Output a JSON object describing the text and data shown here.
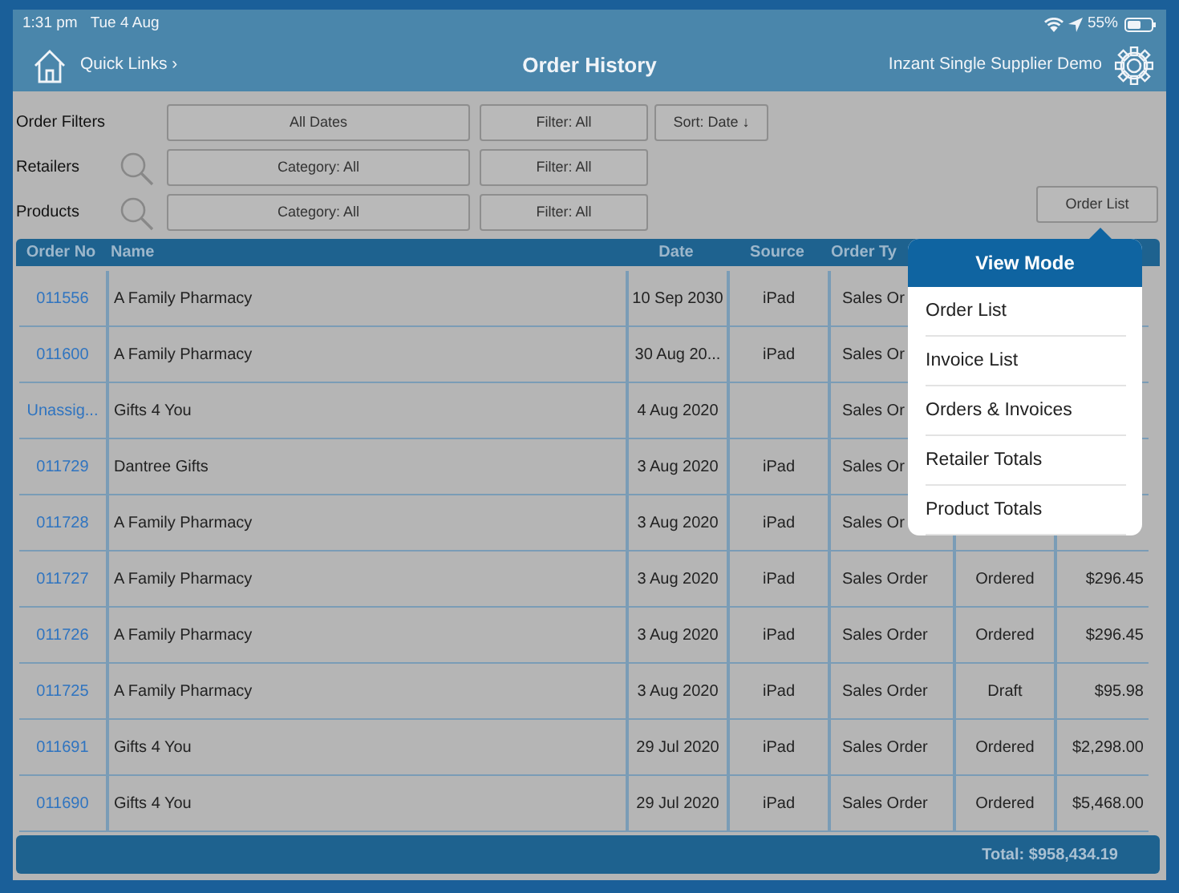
{
  "status_bar": {
    "time": "1:31 pm",
    "date": "Tue 4 Aug",
    "battery": "55%"
  },
  "nav": {
    "quick_links": "Quick Links ›",
    "title": "Order History",
    "account": "Inzant Single Supplier Demo"
  },
  "filters": [
    {
      "label": "Order Filters",
      "search": false,
      "buttons": [
        "All Dates",
        "Filter: All",
        "Sort: Date ↓"
      ]
    },
    {
      "label": "Retailers",
      "search": true,
      "buttons": [
        "Category: All",
        "Filter: All"
      ]
    },
    {
      "label": "Products",
      "search": true,
      "buttons": [
        "Category: All",
        "Filter: All"
      ]
    }
  ],
  "view_button": "Order List",
  "table": {
    "columns": [
      "Order No",
      "Name",
      "Date",
      "Source",
      "Order Ty"
    ],
    "rows": [
      {
        "order_no": "011556",
        "name": "A Family Pharmacy",
        "date": "10 Sep 2030",
        "source": "iPad",
        "order_type": "Sales Or"
      },
      {
        "order_no": "011600",
        "name": "A Family Pharmacy",
        "date": "30 Aug 20...",
        "source": "iPad",
        "order_type": "Sales Or"
      },
      {
        "order_no": "Unassig...",
        "name": "Gifts 4 You",
        "date": "4 Aug 2020",
        "order_type": "Sales Or"
      },
      {
        "order_no": "011729",
        "name": "Dantree Gifts",
        "date": "3 Aug 2020",
        "source": "iPad",
        "order_type": "Sales Or"
      },
      {
        "order_no": "011728",
        "name": "A Family Pharmacy",
        "date": "3 Aug 2020",
        "source": "iPad",
        "order_type": "Sales Or"
      },
      {
        "order_no": "011727",
        "name": "A Family Pharmacy",
        "date": "3 Aug 2020",
        "source": "iPad",
        "order_type": "Sales Order",
        "status": "Ordered",
        "amount": "$296.45"
      },
      {
        "order_no": "011726",
        "name": "A Family Pharmacy",
        "date": "3 Aug 2020",
        "source": "iPad",
        "order_type": "Sales Order",
        "status": "Ordered",
        "amount": "$296.45"
      },
      {
        "order_no": "011725",
        "name": "A Family Pharmacy",
        "date": "3 Aug 2020",
        "source": "iPad",
        "order_type": "Sales Order",
        "status": "Draft",
        "amount": "$95.98"
      },
      {
        "order_no": "011691",
        "name": "Gifts 4 You",
        "date": "29 Jul 2020",
        "source": "iPad",
        "order_type": "Sales Order",
        "status": "Ordered",
        "amount": "$2,298.00"
      },
      {
        "order_no": "011690",
        "name": "Gifts 4 You",
        "date": "29 Jul 2020",
        "source": "iPad",
        "order_type": "Sales Order",
        "status": "Ordered",
        "amount": "$5,468.00"
      }
    ]
  },
  "total": "Total: $958,434.19",
  "popover": {
    "title": "View Mode",
    "items": [
      "Order List",
      "Invoice List",
      "Orders & Invoices",
      "Retailer Totals",
      "Product Totals"
    ]
  }
}
